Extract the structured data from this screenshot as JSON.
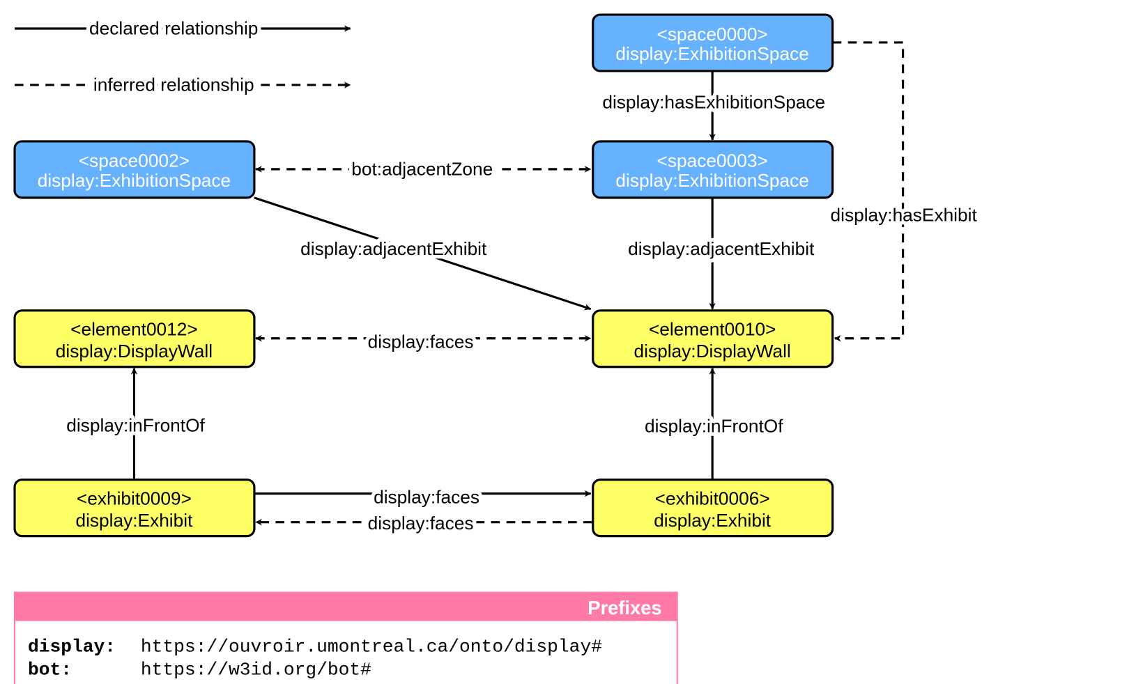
{
  "colors": {
    "space": "#66b2ff",
    "element": "#ffff66",
    "prefix_header": "#ff7ba6"
  },
  "legend": {
    "declared": "declared relationship",
    "inferred": "inferred relationship"
  },
  "nodes": {
    "space0000": {
      "id": "<space0000>",
      "type": "display:ExhibitionSpace"
    },
    "space0002": {
      "id": "<space0002>",
      "type": "display:ExhibitionSpace"
    },
    "space0003": {
      "id": "<space0003>",
      "type": "display:ExhibitionSpace"
    },
    "element0012": {
      "id": "<element0012>",
      "type": "display:DisplayWall"
    },
    "element0010": {
      "id": "<element0010>",
      "type": "display:DisplayWall"
    },
    "exhibit0009": {
      "id": "<exhibit0009>",
      "type": "display:Exhibit"
    },
    "exhibit0006": {
      "id": "<exhibit0006>",
      "type": "display:Exhibit"
    }
  },
  "edges": {
    "has_exhibition_space": {
      "label": "display:hasExhibitionSpace",
      "style": "declared"
    },
    "has_exhibit": {
      "label": "display:hasExhibit",
      "style": "inferred"
    },
    "adjacent_zone": {
      "label": "bot:adjacentZone",
      "style": "inferred"
    },
    "adjacent_exhibit_0002": {
      "label": "display:adjacentExhibit",
      "style": "declared"
    },
    "adjacent_exhibit_0003": {
      "label": "display:adjacentExhibit",
      "style": "declared"
    },
    "faces_walls": {
      "label": "display:faces",
      "style": "inferred"
    },
    "in_front_of_0009": {
      "label": "display:inFrontOf",
      "style": "declared"
    },
    "in_front_of_0006": {
      "label": "display:inFrontOf",
      "style": "declared"
    },
    "faces_0009_0006": {
      "label": "display:faces",
      "style": "declared"
    },
    "faces_0006_0009": {
      "label": "display:faces",
      "style": "inferred"
    }
  },
  "prefixes": {
    "title": "Prefixes",
    "items": [
      {
        "prefix": "display:",
        "uri": "https://ouvroir.umontreal.ca/onto/display#"
      },
      {
        "prefix": "bot:",
        "uri": "https://w3id.org/bot#"
      }
    ]
  }
}
